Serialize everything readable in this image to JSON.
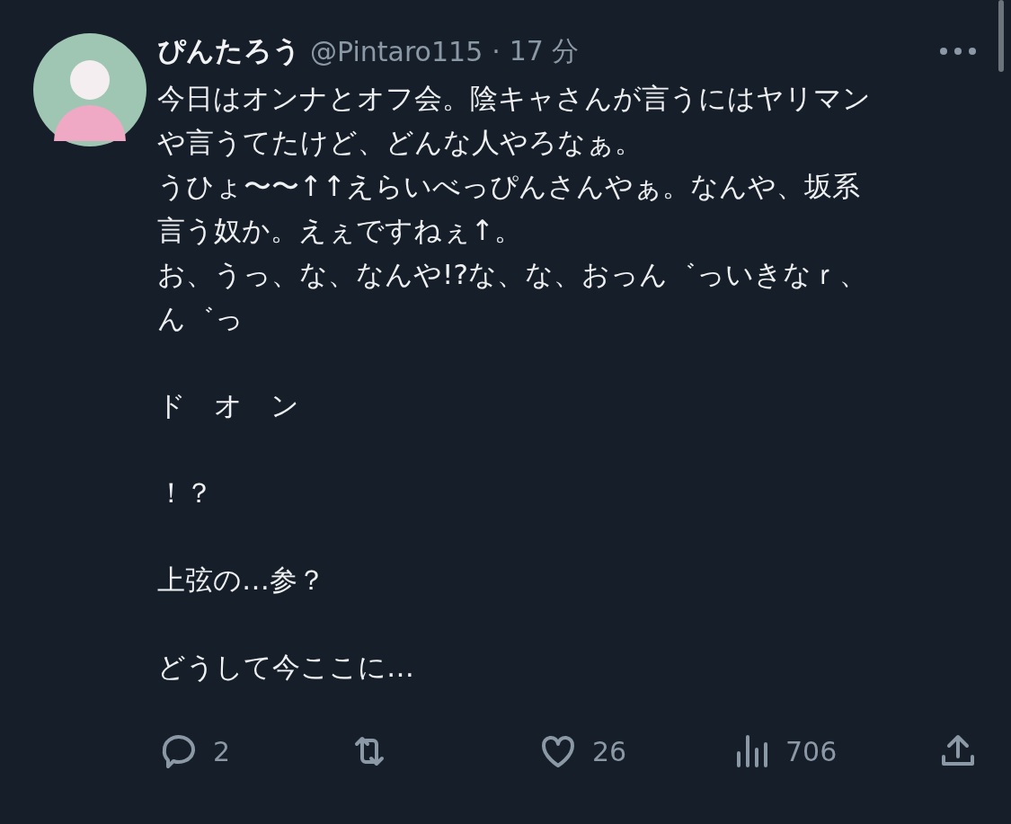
{
  "post": {
    "author_name": "ぴんたろう",
    "handle": "@Pintaro115",
    "separator": "·",
    "time": "17 分",
    "paragraphs": [
      [
        "今日はオンナとオフ会。陰キャさんが言うにはヤリマン",
        "や言うてたけど、どんな人やろなぁ。",
        "うひょ〜〜↑↑えらいべっぴんさんやぁ。なんや、坂系",
        "言う奴か。えぇですねぇ↑。",
        "お、うっ、な、なんや!?な、な、おっん゛っいきなｒ、",
        "ん゛っ"
      ],
      [
        "ド　オ　ン"
      ],
      [
        "！？"
      ],
      [
        "上弦の…参？"
      ],
      [
        "どうして今ここに…"
      ]
    ],
    "actions": [
      {
        "kind": "reply",
        "count": "2"
      },
      {
        "kind": "repost"
      },
      {
        "kind": "like",
        "count": "26"
      },
      {
        "kind": "views",
        "count": "706"
      },
      {
        "kind": "share"
      }
    ]
  }
}
